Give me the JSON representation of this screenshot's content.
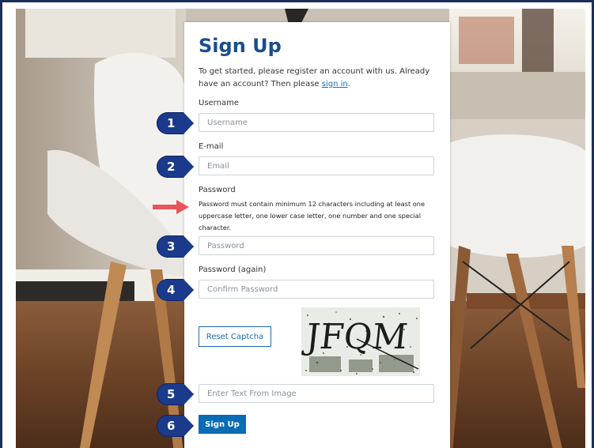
{
  "form": {
    "title": "Sign Up",
    "intro_text": "To get started, please register an account with us. Already have an account? Then please ",
    "signin_link": "sign in",
    "intro_end": ".",
    "username_label": "Username",
    "username_placeholder": "Username",
    "email_label": "E-mail",
    "email_placeholder": "Email",
    "password_label": "Password",
    "password_note": "Password must contain minimum 12 characters including at least one uppercase letter, one lower case letter, one number and one special character.",
    "password_placeholder": "Password",
    "password_again_label": "Password (again)",
    "password_again_placeholder": "Confirm Password",
    "reset_captcha_label": "Reset Captcha",
    "captcha_text": "JFQM",
    "captcha_input_placeholder": "Enter Text From Image",
    "submit_label": "Sign Up"
  },
  "annotations": {
    "badges": [
      "1",
      "2",
      "3",
      "4",
      "5",
      "6"
    ],
    "badge_color": "#1b3a8c",
    "arrow_color": "#e8545b"
  },
  "colors": {
    "title": "#1a4f8a",
    "link": "#1a6cb0",
    "primary_button": "#0a6cb4"
  }
}
